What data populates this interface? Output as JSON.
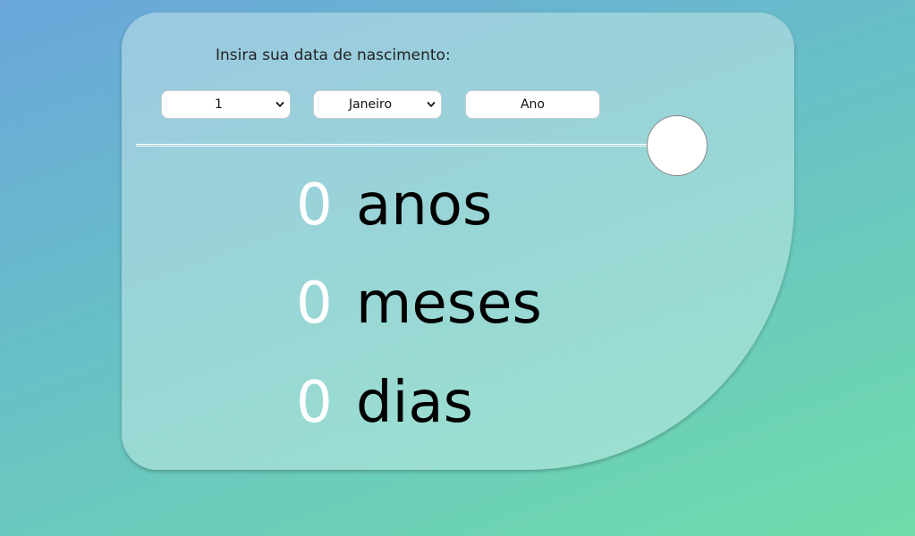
{
  "form": {
    "prompt": "Insira sua data de nascimento:",
    "day_value": "1",
    "month_value": "Janeiro",
    "year_placeholder": "Ano"
  },
  "results": {
    "years": {
      "value": "0",
      "unit": "anos"
    },
    "months": {
      "value": "0",
      "unit": "meses"
    },
    "days": {
      "value": "0",
      "unit": "dias"
    }
  },
  "colors": {
    "background_start": "#6aa6db",
    "background_end": "#6fdcaa",
    "number_color": "#ffffff",
    "unit_color": "#000000"
  },
  "icons": {
    "select_arrow": "chevron-down-icon",
    "submit": "circle-button"
  }
}
